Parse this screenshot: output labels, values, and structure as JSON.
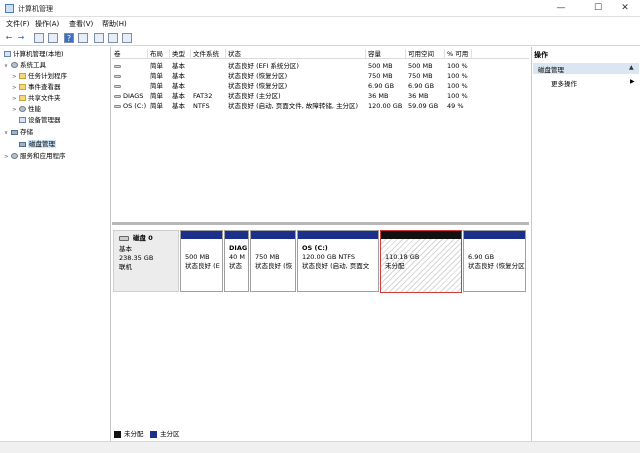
{
  "window": {
    "title": "计算机管理",
    "min": "—",
    "max": "☐",
    "close": "✕"
  },
  "menu": [
    "文件(F)",
    "操作(A)",
    "查看(V)",
    "帮助(H)"
  ],
  "toolbar": {
    "back": "←",
    "forward": "→",
    "help": "?",
    "icons": [
      "folder-icon",
      "properties-icon",
      "help-icon",
      "view-icon",
      "export-icon",
      "refresh-icon"
    ]
  },
  "tree": [
    {
      "label": "计算机管理(本地)",
      "level": 0,
      "arrow": "",
      "icon": "computer"
    },
    {
      "label": "系统工具",
      "level": 1,
      "arrow": "∨",
      "icon": "gear"
    },
    {
      "label": "任务计划程序",
      "level": 2,
      "arrow": ">",
      "icon": "folder"
    },
    {
      "label": "事件查看器",
      "level": 2,
      "arrow": ">",
      "icon": "folder"
    },
    {
      "label": "共享文件夹",
      "level": 2,
      "arrow": ">",
      "icon": "folder"
    },
    {
      "label": "性能",
      "level": 2,
      "arrow": ">",
      "icon": "gear"
    },
    {
      "label": "设备管理器",
      "level": 2,
      "arrow": "",
      "icon": "computer"
    },
    {
      "label": "存储",
      "level": 1,
      "arrow": "∨",
      "icon": "disk"
    },
    {
      "label": "磁盘管理",
      "level": 2,
      "arrow": "",
      "icon": "disk",
      "selected": true
    },
    {
      "label": "服务和应用程序",
      "level": 1,
      "arrow": ">",
      "icon": "gear"
    }
  ],
  "volumes": {
    "headers": [
      "卷",
      "布局",
      "类型",
      "文件系统",
      "状态",
      "容量",
      "可用空间",
      "% 可用"
    ],
    "rows": [
      [
        "",
        "简单",
        "基本",
        "",
        "状态良好 (EFI 系统分区)",
        "500 MB",
        "500 MB",
        "100 %"
      ],
      [
        "",
        "简单",
        "基本",
        "",
        "状态良好 (恢复分区)",
        "750 MB",
        "750 MB",
        "100 %"
      ],
      [
        "",
        "简单",
        "基本",
        "",
        "状态良好 (恢复分区)",
        "6.90 GB",
        "6.90 GB",
        "100 %"
      ],
      [
        "DIAGS",
        "简单",
        "基本",
        "FAT32",
        "状态良好 (主分区)",
        "36 MB",
        "36 MB",
        "100 %"
      ],
      [
        "OS (C:)",
        "简单",
        "基本",
        "NTFS",
        "状态良好 (启动, 页面文件, 故障转储, 主分区)",
        "120.00 GB",
        "59.09 GB",
        "49 %"
      ]
    ]
  },
  "disk": {
    "name": "磁盘 0",
    "type": "基本",
    "size": "238.35 GB",
    "status": "联机"
  },
  "partitions": [
    {
      "name": "",
      "line1": "500 MB",
      "line2": "状态良好 (E",
      "kind": "primary"
    },
    {
      "name": "DIAG",
      "line1": "40 M",
      "line2": "状态",
      "kind": "primary"
    },
    {
      "name": "",
      "line1": "750 MB",
      "line2": "状态良好 (恢",
      "kind": "primary"
    },
    {
      "name": "OS  (C:)",
      "line1": "120.00 GB NTFS",
      "line2": "状态良好 (启动, 页面文",
      "kind": "primary"
    },
    {
      "name": "",
      "line1": "110.18 GB",
      "line2": "未分配",
      "kind": "unallocated"
    },
    {
      "name": "",
      "line1": "6.90 GB",
      "line2": "状态良好 (恢复分区)",
      "kind": "primary"
    }
  ],
  "legend": [
    {
      "label": "未分配",
      "color": "#111111"
    },
    {
      "label": "主分区",
      "color": "#1c2f8a"
    }
  ],
  "actions": {
    "header": "操作",
    "section": "磁盘管理",
    "section_arrow": "▲",
    "more": "更多操作",
    "more_arrow": "▶"
  }
}
